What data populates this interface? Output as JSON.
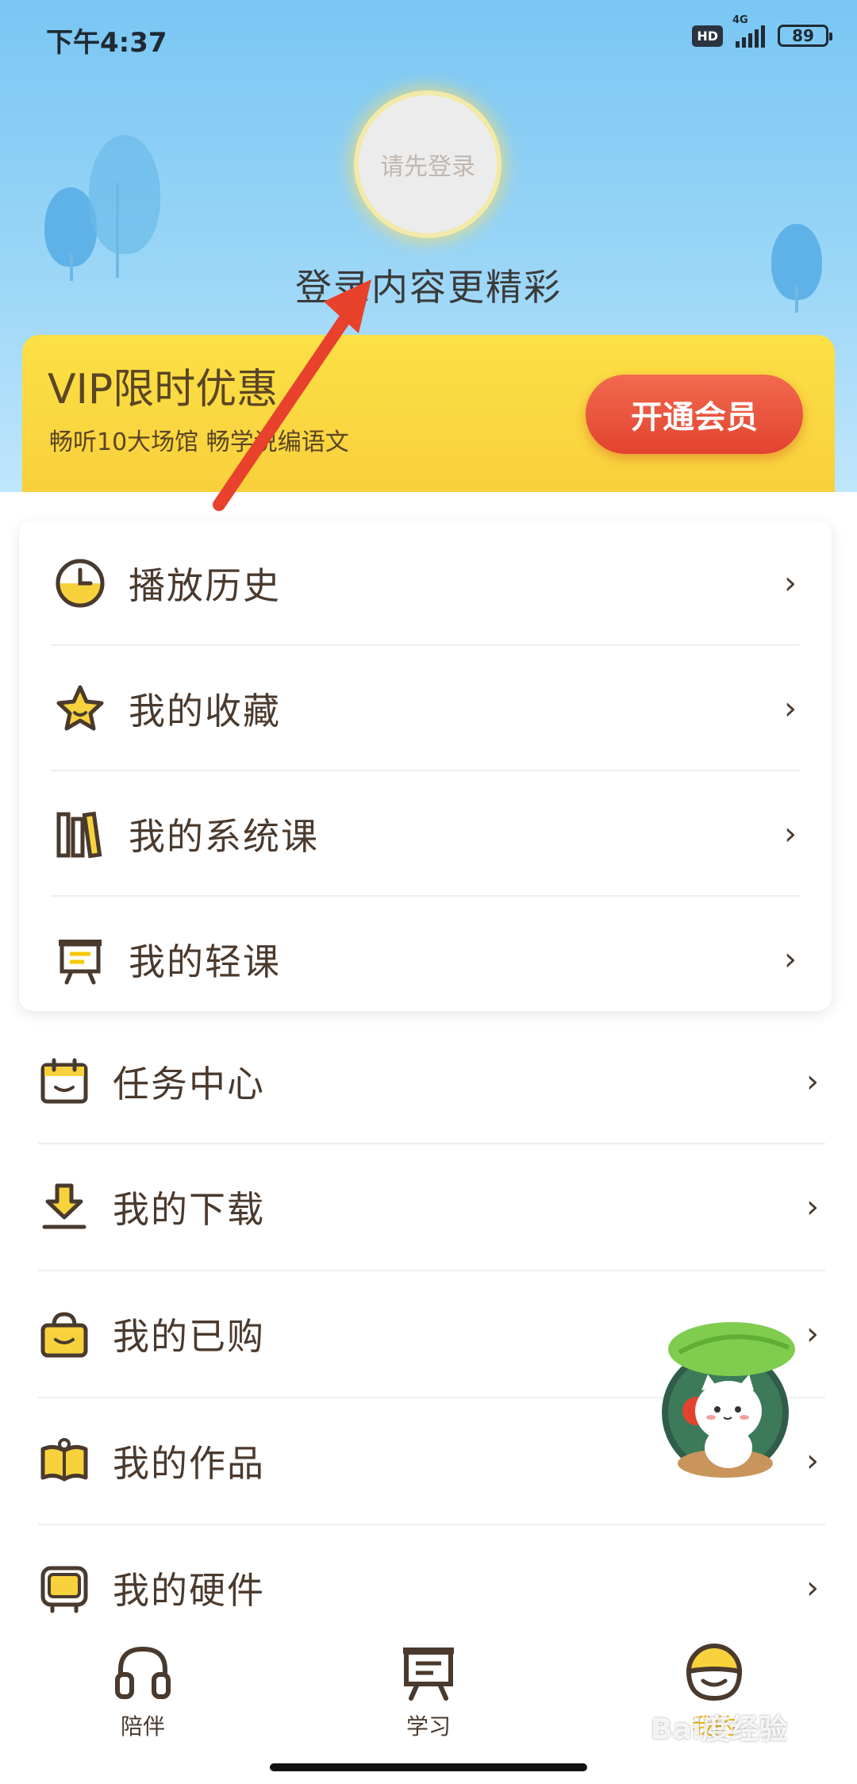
{
  "status_bar": {
    "time": "下午4:37",
    "hd": "HD",
    "network": "4G",
    "battery": "89"
  },
  "profile": {
    "avatar_text": "请先登录",
    "login_tip": "登录内容更精彩"
  },
  "vip": {
    "title": "VIP限时优惠",
    "subtitle": "畅听10大场馆 畅学说编语文",
    "button": "开通会员"
  },
  "card_menu": [
    {
      "label": "播放历史",
      "icon": "clock-icon"
    },
    {
      "label": "我的收藏",
      "icon": "star-icon"
    },
    {
      "label": "我的系统课",
      "icon": "books-icon"
    },
    {
      "label": "我的轻课",
      "icon": "easel-icon"
    }
  ],
  "menu": [
    {
      "label": "任务中心",
      "icon": "calendar-icon"
    },
    {
      "label": "我的下载",
      "icon": "download-icon"
    },
    {
      "label": "我的已购",
      "icon": "basket-icon"
    },
    {
      "label": "我的作品",
      "icon": "open-book-icon"
    },
    {
      "label": "我的硬件",
      "icon": "device-icon"
    }
  ],
  "tabbar": [
    {
      "label": "陪伴",
      "icon": "headphones-icon",
      "active": false
    },
    {
      "label": "学习",
      "icon": "easel-icon",
      "active": false
    },
    {
      "label": "我的",
      "icon": "smile-icon",
      "active": true
    }
  ],
  "watermark": "Bai度经验",
  "colors": {
    "accent": "#f2b510",
    "vip_bg": "#fce045",
    "vip_button": "#e2432f",
    "text": "#4a3a2e",
    "header_sky": "#79c6f4",
    "arrow": "#e8412c"
  }
}
